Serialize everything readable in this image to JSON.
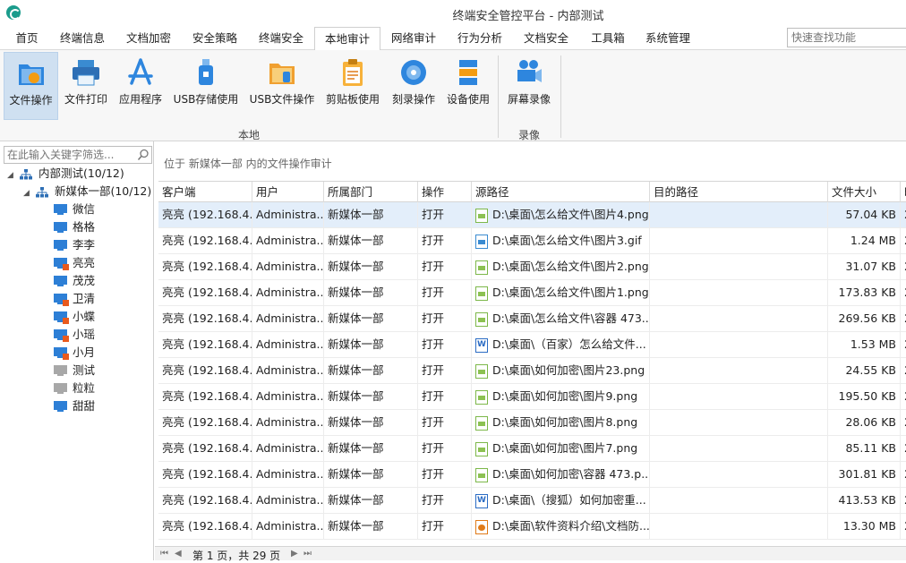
{
  "window": {
    "title": "终端安全管控平台 - 内部测试"
  },
  "menu": {
    "tabs": [
      {
        "label": "首页"
      },
      {
        "label": "终端信息"
      },
      {
        "label": "文档加密"
      },
      {
        "label": "安全策略"
      },
      {
        "label": "终端安全"
      },
      {
        "label": "本地审计"
      },
      {
        "label": "网络审计"
      },
      {
        "label": "行为分析"
      },
      {
        "label": "文档安全"
      },
      {
        "label": "工具箱"
      },
      {
        "label": "系统管理"
      }
    ],
    "active_index": 5,
    "quick_search_placeholder": "快速查找功能"
  },
  "ribbon": {
    "buttons": [
      {
        "label": "文件操作",
        "icon": "file-operation-icon"
      },
      {
        "label": "文件打印",
        "icon": "printer-icon"
      },
      {
        "label": "应用程序",
        "icon": "app-store-icon"
      },
      {
        "label": "USB存储使用",
        "icon": "usb-drive-icon"
      },
      {
        "label": "USB文件操作",
        "icon": "usb-file-icon"
      },
      {
        "label": "剪贴板使用",
        "icon": "clipboard-icon"
      },
      {
        "label": "刻录操作",
        "icon": "disc-burn-icon"
      },
      {
        "label": "设备使用",
        "icon": "device-icon"
      },
      {
        "label": "屏幕录像",
        "icon": "video-camera-icon"
      }
    ],
    "groups": [
      {
        "label": "本地"
      },
      {
        "label": "录像"
      }
    ]
  },
  "tree": {
    "filter_placeholder": "在此输入关键字筛选...",
    "root": "内部测试(10/12)",
    "dept": "新媒体一部(10/12)",
    "endpoints": [
      {
        "name": "微信",
        "status": "online"
      },
      {
        "name": "格格",
        "status": "online"
      },
      {
        "name": "李李",
        "status": "online"
      },
      {
        "name": "亮亮",
        "status": "alert"
      },
      {
        "name": "茂茂",
        "status": "online"
      },
      {
        "name": "卫清",
        "status": "alert"
      },
      {
        "name": "小蝶",
        "status": "alert"
      },
      {
        "name": "小瑶",
        "status": "alert"
      },
      {
        "name": "小月",
        "status": "alert"
      },
      {
        "name": "测试",
        "status": "offline"
      },
      {
        "name": "粒粒",
        "status": "offline"
      },
      {
        "name": "甜甜",
        "status": "online"
      }
    ]
  },
  "main": {
    "breadcrumb": "位于 新媒体一部 内的文件操作审计",
    "columns": [
      "客户端",
      "用户",
      "所属部门",
      "操作",
      "源路径",
      "目的路径",
      "文件大小",
      "时"
    ],
    "rows": [
      {
        "client": "亮亮 (192.168.4...",
        "user": "Administra...",
        "dept": "新媒体一部",
        "op": "打开",
        "icon": "png",
        "src": "D:\\桌面\\怎么给文件\\图片4.png",
        "dst": "",
        "size": "57.04 KB",
        "time": "2"
      },
      {
        "client": "亮亮 (192.168.4...",
        "user": "Administra...",
        "dept": "新媒体一部",
        "op": "打开",
        "icon": "gif",
        "src": "D:\\桌面\\怎么给文件\\图片3.gif",
        "dst": "",
        "size": "1.24 MB",
        "time": "2"
      },
      {
        "client": "亮亮 (192.168.4...",
        "user": "Administra...",
        "dept": "新媒体一部",
        "op": "打开",
        "icon": "png",
        "src": "D:\\桌面\\怎么给文件\\图片2.png",
        "dst": "",
        "size": "31.07 KB",
        "time": "2"
      },
      {
        "client": "亮亮 (192.168.4...",
        "user": "Administra...",
        "dept": "新媒体一部",
        "op": "打开",
        "icon": "png",
        "src": "D:\\桌面\\怎么给文件\\图片1.png",
        "dst": "",
        "size": "173.83 KB",
        "time": "2"
      },
      {
        "client": "亮亮 (192.168.4...",
        "user": "Administra...",
        "dept": "新媒体一部",
        "op": "打开",
        "icon": "png",
        "src": "D:\\桌面\\怎么给文件\\容器 473...",
        "dst": "",
        "size": "269.56 KB",
        "time": "2"
      },
      {
        "client": "亮亮 (192.168.4...",
        "user": "Administra...",
        "dept": "新媒体一部",
        "op": "打开",
        "icon": "doc",
        "src": "D:\\桌面\\（百家）怎么给文件...",
        "dst": "",
        "size": "1.53 MB",
        "time": "2"
      },
      {
        "client": "亮亮 (192.168.4...",
        "user": "Administra...",
        "dept": "新媒体一部",
        "op": "打开",
        "icon": "png",
        "src": "D:\\桌面\\如何加密\\图片23.png",
        "dst": "",
        "size": "24.55 KB",
        "time": "2"
      },
      {
        "client": "亮亮 (192.168.4...",
        "user": "Administra...",
        "dept": "新媒体一部",
        "op": "打开",
        "icon": "png",
        "src": "D:\\桌面\\如何加密\\图片9.png",
        "dst": "",
        "size": "195.50 KB",
        "time": "2"
      },
      {
        "client": "亮亮 (192.168.4...",
        "user": "Administra...",
        "dept": "新媒体一部",
        "op": "打开",
        "icon": "png",
        "src": "D:\\桌面\\如何加密\\图片8.png",
        "dst": "",
        "size": "28.06 KB",
        "time": "2"
      },
      {
        "client": "亮亮 (192.168.4...",
        "user": "Administra...",
        "dept": "新媒体一部",
        "op": "打开",
        "icon": "png",
        "src": "D:\\桌面\\如何加密\\图片7.png",
        "dst": "",
        "size": "85.11 KB",
        "time": "2"
      },
      {
        "client": "亮亮 (192.168.4...",
        "user": "Administra...",
        "dept": "新媒体一部",
        "op": "打开",
        "icon": "png",
        "src": "D:\\桌面\\如何加密\\容器 473.p...",
        "dst": "",
        "size": "301.81 KB",
        "time": "2"
      },
      {
        "client": "亮亮 (192.168.4...",
        "user": "Administra...",
        "dept": "新媒体一部",
        "op": "打开",
        "icon": "doc",
        "src": "D:\\桌面\\（搜狐）如何加密重...",
        "dst": "",
        "size": "413.53 KB",
        "time": "2"
      },
      {
        "client": "亮亮 (192.168.4...",
        "user": "Administra...",
        "dept": "新媒体一部",
        "op": "打开",
        "icon": "ppt",
        "src": "D:\\桌面\\软件资料介绍\\文档防...",
        "dst": "",
        "size": "13.30 MB",
        "time": "2"
      }
    ]
  },
  "pager": {
    "text": "第 1 页，共 29 页"
  }
}
